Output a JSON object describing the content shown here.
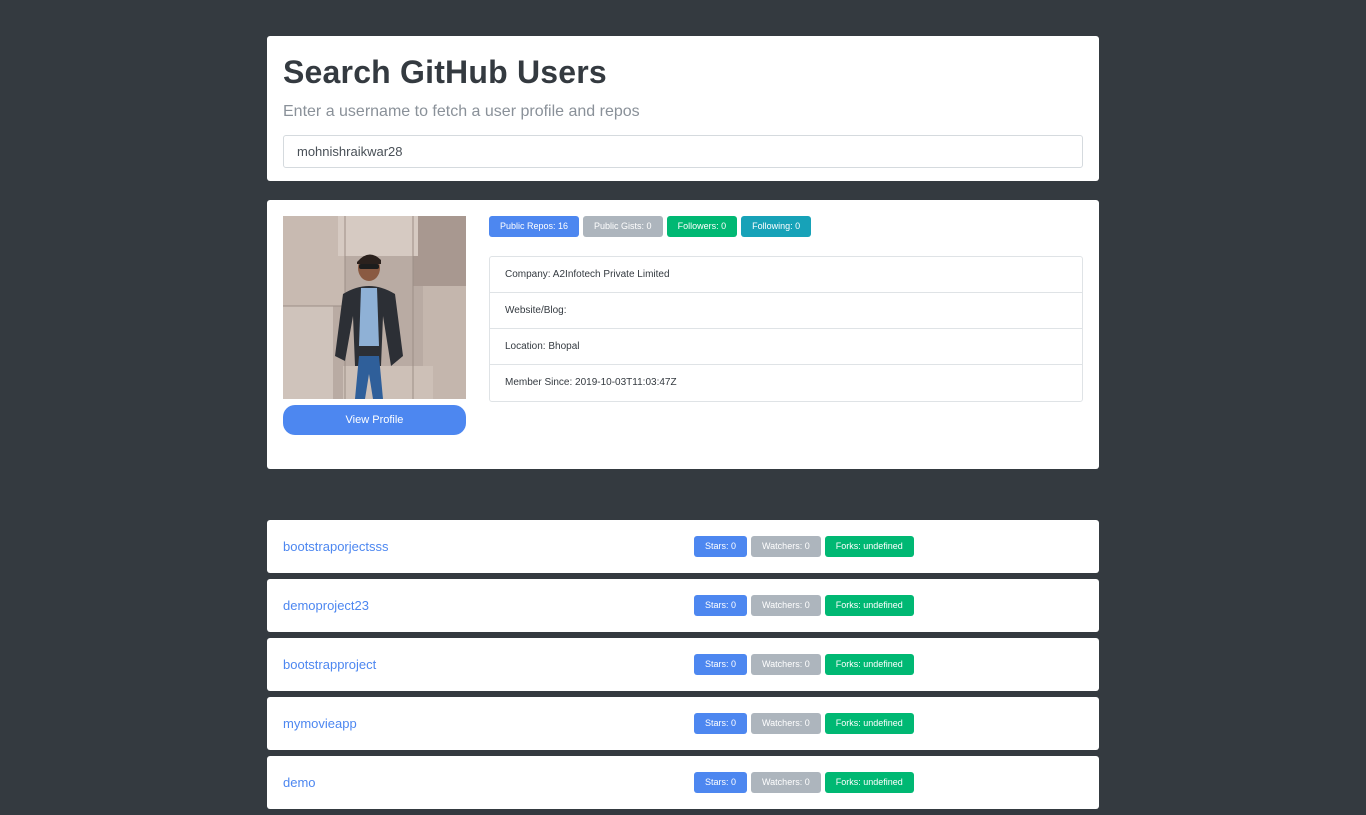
{
  "search": {
    "title": "Search GitHub Users",
    "subtitle": "Enter a username to fetch a user profile and repos",
    "value": "mohnishraikwar28"
  },
  "profile": {
    "view_profile_label": "View Profile",
    "badges": {
      "public_repos": "Public Repos: 16",
      "public_gists": "Public Gists: 0",
      "followers": "Followers: 0",
      "following": "Following: 0"
    },
    "info": {
      "company": "Company: A2Infotech Private Limited",
      "website": "Website/Blog:",
      "location": "Location: Bhopal",
      "member_since": "Member Since: 2019-10-03T11:03:47Z"
    }
  },
  "repos": [
    {
      "name": "bootstraporjectsss",
      "stars": "Stars: 0",
      "watchers": "Watchers: 0",
      "forks": "Forks: undefined"
    },
    {
      "name": "demoproject23",
      "stars": "Stars: 0",
      "watchers": "Watchers: 0",
      "forks": "Forks: undefined"
    },
    {
      "name": "bootstrapproject",
      "stars": "Stars: 0",
      "watchers": "Watchers: 0",
      "forks": "Forks: undefined"
    },
    {
      "name": "mymovieapp",
      "stars": "Stars: 0",
      "watchers": "Watchers: 0",
      "forks": "Forks: undefined"
    },
    {
      "name": "demo",
      "stars": "Stars: 0",
      "watchers": "Watchers: 0",
      "forks": "Forks: undefined"
    }
  ],
  "colors": {
    "background": "#343a40",
    "primary": "#4d87f0",
    "secondary": "#adb5bd",
    "success": "#00b873",
    "info": "#17a2b8"
  },
  "icons": {
    "avatar": "user-photo"
  }
}
